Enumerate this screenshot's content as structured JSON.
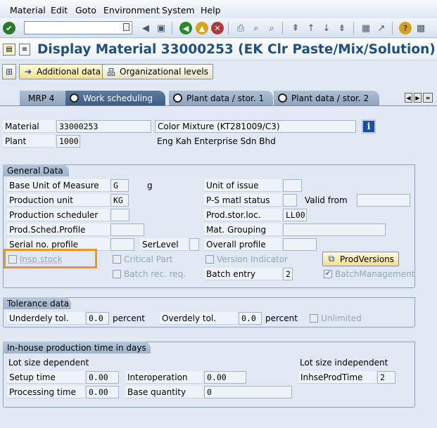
{
  "menu": [
    "Material",
    "Edit",
    "Goto",
    "Environment",
    "System",
    "Help"
  ],
  "toolbar_icons": [
    "enter-icon",
    "command-field",
    "back-icon",
    "save-icon",
    "exit-icon",
    "logoff-icon",
    "cancel-icon",
    "print-icon",
    "find-icon",
    "find-next-icon",
    "first-page-icon",
    "prev-page-icon",
    "next-page-icon",
    "last-page-icon",
    "create-session-icon",
    "shortcut-icon",
    "help-icon",
    "customize-icon"
  ],
  "title": "Display Material 33000253 (EK Clr Paste/Mix/Solution)",
  "app_toolbar": {
    "additional_data": "Additional data",
    "org_levels": "Organizational levels"
  },
  "tabs": [
    "MRP 4",
    "Work scheduling",
    "Plant data / stor. 1",
    "Plant data / stor. 2"
  ],
  "active_tab": "Work scheduling",
  "header": {
    "material_label": "Material",
    "material_value": "33000253",
    "material_desc": "Color Mixture (KT281009/C3)",
    "plant_label": "Plant",
    "plant_value": "1000",
    "plant_desc": "Eng Kah Enterprise Sdn Bhd"
  },
  "general": {
    "title": "General Data",
    "base_uom_label": "Base Unit of Measure",
    "base_uom_value": "G",
    "base_uom_text": "g",
    "unit_issue_label": "Unit of issue",
    "unit_issue_value": "",
    "prod_unit_label": "Production unit",
    "prod_unit_value": "KG",
    "ps_status_label": "P-S matl status",
    "ps_status_value": "",
    "valid_from_label": "Valid from",
    "valid_from_value": "",
    "prod_sched_label": "Production scheduler",
    "prod_sched_value": "",
    "prod_stor_label": "Prod.stor.loc.",
    "prod_stor_value": "LL00",
    "sched_profile_label": "Prod.Sched.Profile",
    "sched_profile_value": "",
    "mat_group_label": "Mat. Grouping",
    "mat_group_value": "",
    "serial_label": "Serial no. profile",
    "serial_value": "",
    "serlevel_label": "SerLevel",
    "serlevel_value": "",
    "overall_label": "Overall profile",
    "overall_value": "",
    "insp_stock_label": "Insp.stock",
    "critical_part_label": "Critical Part",
    "version_ind_label": "Version Indicator",
    "prodversions_label": "ProdVersions",
    "batch_rec_label": "Batch rec. req.",
    "batch_entry_label": "Batch entry",
    "batch_entry_value": "2",
    "batch_mgmt_label": "BatchManagement"
  },
  "tolerance": {
    "title": "Tolerance data",
    "under_label": "Underdely tol.",
    "under_value": "0.0",
    "under_unit": "percent",
    "over_label": "Overdely tol.",
    "over_value": "0.0",
    "over_unit": "percent",
    "unlimited_label": "Unlimited"
  },
  "inhouse": {
    "title": "In-house production time in days",
    "lot_dep_label": "Lot size dependent",
    "lot_indep_label": "Lot size independent",
    "setup_label": "Setup time",
    "setup_value": "0.00",
    "interop_label": "Interoperation",
    "interop_value": "0.00",
    "inhse_label": "InhseProdTime",
    "inhse_value": "2",
    "proc_label": "Processing time",
    "proc_value": "0.00",
    "base_qty_label": "Base quantity",
    "base_qty_value": "0"
  },
  "colors": {
    "title": "#1f4f7f",
    "highlight": "#f29226",
    "active_tab": "#3f5d83"
  }
}
